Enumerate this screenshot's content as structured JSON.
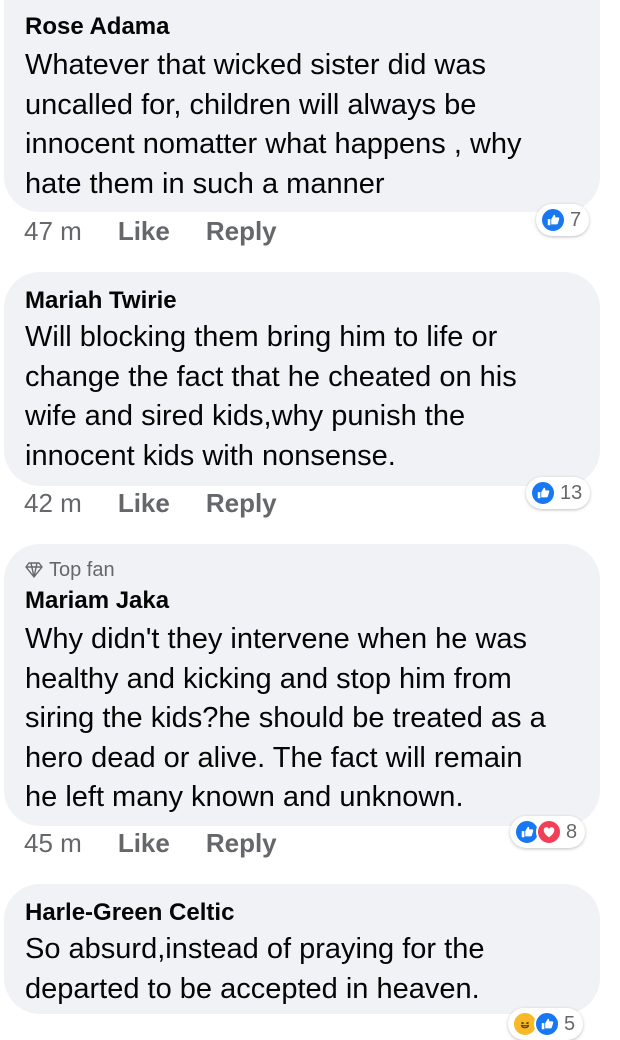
{
  "comments": [
    {
      "author": "Rose Adama",
      "lines": [
        "Whatever that wicked sister did was",
        "uncalled for, children will always be",
        "innocent nomatter what happens , why",
        "hate them in such a manner"
      ],
      "time": "47 m",
      "like_label": "Like",
      "reply_label": "Reply",
      "reactions_count": "7"
    },
    {
      "author": "Mariah Twirie",
      "lines": [
        "Will blocking them bring him to life or",
        "change the fact that he cheated on his",
        "wife and sired kids,why punish the",
        "innocent kids with nonsense."
      ],
      "time": "42 m",
      "like_label": "Like",
      "reply_label": "Reply",
      "reactions_count": "13"
    },
    {
      "badge": "Top fan",
      "author": "Mariam Jaka",
      "lines": [
        "Why didn't they intervene when he was",
        "healthy and kicking and stop him from",
        "siring the kids?he should be treated as a",
        "hero dead or alive. The fact will remain",
        "he left many known and unknown."
      ],
      "time": "45 m",
      "like_label": "Like",
      "reply_label": "Reply",
      "reactions_count": "8"
    },
    {
      "author": "Harle-Green Celtic",
      "lines": [
        "So absurd,instead of praying for the",
        "departed to be accepted in heaven."
      ],
      "reactions_count": "5"
    }
  ],
  "icons": [
    "like-icon",
    "love-icon",
    "haha-icon",
    "diamond-icon"
  ],
  "colors": {
    "bubble": "#f0f2f5",
    "like": "#1877f2",
    "love": "#f33e58",
    "meta": "#65676b"
  }
}
